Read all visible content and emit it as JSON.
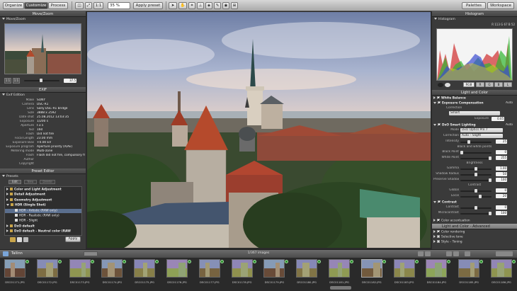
{
  "toolbar": {
    "tabs": [
      "Organize",
      "Customize",
      "Process"
    ],
    "zoom": "35 %",
    "zoom_ratio": "1:1",
    "apply_preset": "Apply preset",
    "palettes": "Palettes",
    "workspace": "Workspace"
  },
  "move_zoom": {
    "title": "Move/Zoom",
    "sub": "Move/Zoom",
    "zoom_a": "1:1",
    "zoom_b": "1:1",
    "zoom_val": "37.5"
  },
  "exif": {
    "title": "EXIF",
    "sub": "Exif Edition",
    "rows": [
      {
        "k": "Make",
        "v": "SONY"
      },
      {
        "k": "Camera",
        "v": "DSC-R1"
      },
      {
        "k": "Lens",
        "v": "Sony DSC-R1 bridge"
      },
      {
        "k": "Size",
        "v": "3888 x 2592"
      },
      {
        "k": "Date shot",
        "v": "25.08.2012 13:03:35"
      },
      {
        "k": "Exposure",
        "v": "1/200 s"
      },
      {
        "k": "Aperture",
        "v": "F3.5"
      },
      {
        "k": "ISO",
        "v": "160"
      },
      {
        "k": "Flash",
        "v": "Did not fire"
      },
      {
        "k": "Focal Length",
        "v": "23.00 mm"
      },
      {
        "k": "Exposure Bias",
        "v": "+0.00 EV"
      },
      {
        "k": "Exposure program",
        "v": "Aperture priority (A/Av)"
      },
      {
        "k": "Metering mode",
        "v": "Multi-zone"
      },
      {
        "k": "Flash",
        "v": "Flash did not fire, compulsory fl."
      },
      {
        "k": "Author",
        "v": ""
      },
      {
        "k": "Copyright",
        "v": ""
      }
    ]
  },
  "preset_editor": {
    "title": "Preset Editor",
    "sub": "Presets",
    "buttons": [
      "Edit",
      "New",
      "Delete"
    ],
    "items": [
      {
        "label": "Color and Light Adjustment",
        "bold": true,
        "expanded": false
      },
      {
        "label": "Detail Adjustment",
        "bold": true,
        "expanded": false
      },
      {
        "label": "Geometry Adjustment",
        "bold": true,
        "expanded": false
      },
      {
        "label": "HDR (Single Shot)",
        "bold": true,
        "expanded": true
      },
      {
        "label": "HDR - Artistic (RAW only)",
        "bold": false,
        "selected": true
      },
      {
        "label": "HDR - Realistic (RAW only)",
        "bold": false
      },
      {
        "label": "HDR - Slight",
        "bold": false
      },
      {
        "label": "DxO default",
        "bold": true
      },
      {
        "label": "DxO default - Neutral color (RAW",
        "bold": true
      }
    ],
    "apply": "Apply"
  },
  "histogram": {
    "title": "Histogram",
    "sub": "Histogram",
    "readout": "R 113 G 67 B 52",
    "channels": [
      "RGB",
      "R",
      "G",
      "B",
      "L"
    ]
  },
  "light_color": {
    "title": "Light and Color",
    "sections": [
      {
        "label": "White Balance",
        "checked": true
      },
      {
        "label": "Exposure Compensation",
        "checked": true,
        "auto": "Auto"
      }
    ],
    "correction_label": "Correction",
    "correction_value": "Smart",
    "exposure_label": "Exposure",
    "exposure_value": "0.05",
    "smart_lighting": "DxO Smart Lighting",
    "smart_auto": "Auto",
    "mode_label": "Mode",
    "mode_value": "DxO Optics Pro 7",
    "correction2_label": "Correction",
    "correction2_value": "Auto – Slight",
    "intensity_label": "Intensity",
    "intensity_value": "25",
    "bwp_title": "Black and white points",
    "black_label": "Black Point",
    "black_value": "0",
    "white_label": "White Point",
    "white_value": "255",
    "brightness_title": "Brightness",
    "gamma_label": "Gamma",
    "gamma_value": "1.00",
    "shadow_label": "Shadow Radius",
    "shadow_value": "50",
    "preserve_label": "Preserve Shadows",
    "preserve_value": "100",
    "contrast_title": "Contrast",
    "global_label": "Global",
    "global_value": "0",
    "local_label": "Local",
    "local_value": "20",
    "contrast_section": "Contrast",
    "contrast_label": "Contrast",
    "contrast_value": "0",
    "micro_label": "Microcontrast",
    "micro_value": "100",
    "color_accent": "Color accentuation",
    "light_adv": "Light and Color - Advanced",
    "color_render": "Color rendering",
    "selective": "Selective tone",
    "style": "Style – Toning"
  },
  "filmstrip": {
    "folder": "Tallinn",
    "count": "1/367 images",
    "files": [
      "DSC01171.JPG",
      "DSC01172.JPG",
      "DSC01173.JPG",
      "DSC01174.JPG",
      "DSC01175.JPG",
      "DSC01176.JPG",
      "DSC01177.JPG",
      "DSC01178.JPG",
      "DSC01179.JPG",
      "DSC01180.JPG",
      "DSC01181.JPG",
      "DSC01182.JPG",
      "DSC01183.JPG",
      "DSC01184.JPG",
      "DSC01185.JPG",
      "DSC01186.JPG"
    ],
    "selected_index": 11
  },
  "colors": {
    "accent": "#5b6f8e",
    "panel_bg": "#3a3a3a",
    "histogram_bg": "#f4f4f4"
  }
}
